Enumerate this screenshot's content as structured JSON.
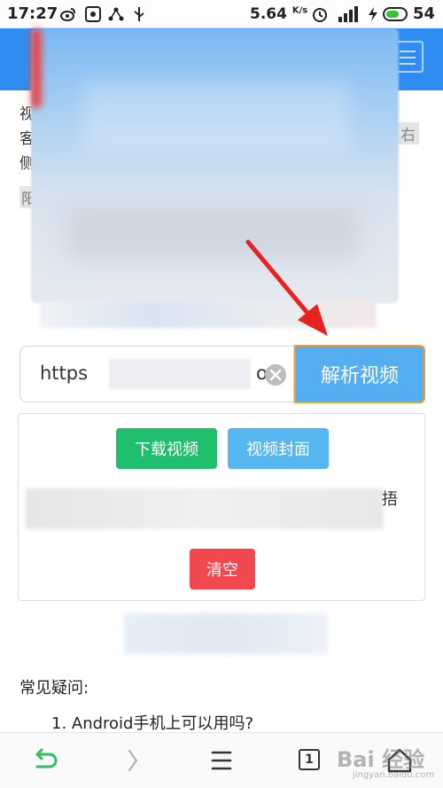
{
  "status_bar": {
    "time": "17:27",
    "network_speed": "5.64",
    "network_speed_unit": "K/s",
    "battery": "54"
  },
  "page_text": {
    "line1_start": "视",
    "line2_start": "客",
    "line3_start": "侧",
    "line2_end": "右",
    "line4_start": "阳"
  },
  "url_input": {
    "value_start": "https",
    "value_end": "o"
  },
  "parse_button": {
    "label": "解析视频"
  },
  "result_panel": {
    "download_label": "下载视频",
    "cover_label": "视频封面",
    "clear_label": "清空",
    "text_tail": "捂"
  },
  "faq": {
    "title": "常见疑问:",
    "items": [
      "1. Android手机上可以用吗?"
    ]
  },
  "bottom_nav": {
    "tab_count": "1",
    "watermark": "Bai 经验",
    "watermark_sub": "jingyan.baidu.com"
  },
  "colors": {
    "header_blue": "#2f8cf0",
    "parse_button": "#55aef0",
    "download_button": "#1fbf6e",
    "cover_button": "#55b6f0",
    "clear_button": "#f0484d",
    "arrow": "#e8231f"
  }
}
